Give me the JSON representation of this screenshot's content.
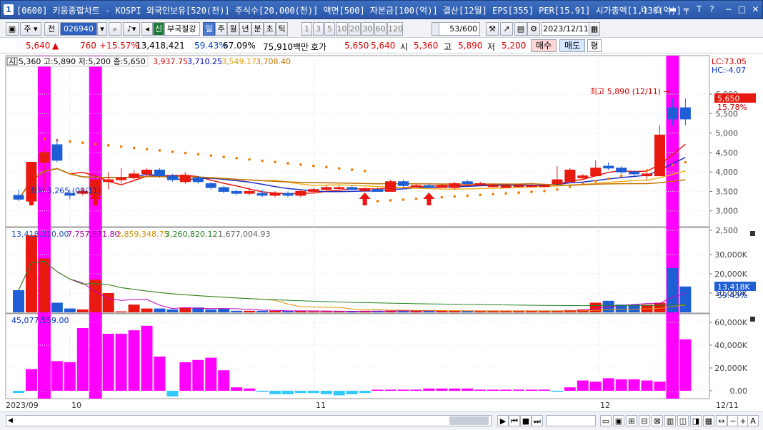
{
  "window": {
    "title": "[0600] 키움종합차트 - KOSPI 외국인보유[520(천)] 주식수[20,000(천)] 액면[500] 자본금[100(억)] 결산[12월] EPS[355] PER[15.91] 시가총액[1,130(억)]",
    "app_icon": "1",
    "buttons": {
      "restore": "⧉",
      "print": "⎙",
      "min": "▬",
      "pin": "╤",
      "tile": "T",
      "help": "?",
      "minimize": "−",
      "maximize": "□",
      "close": "✕"
    }
  },
  "toolbar": {
    "type_label": "주",
    "prev_label": "전",
    "code": "026940",
    "market_badge": "신",
    "stock_name": "부국철강",
    "periods": [
      "일",
      "주",
      "월",
      "년",
      "분",
      "초",
      "틱"
    ],
    "selected_period": "일",
    "intervals": [
      "1",
      "3",
      "5",
      "10",
      "20",
      "30",
      "60",
      "120"
    ],
    "count": "53/600",
    "date": "2023/12/11"
  },
  "quote": {
    "price": "5,640",
    "change_arrow": "▲",
    "change": "760",
    "change_pct": "+15.57%",
    "volume": "13,418,421",
    "vol_ratio": "59.43%",
    "turnover": "67.09%",
    "amount": "75,910백만",
    "hoga_label": "호가",
    "ask": "5,650",
    "bid": "5,640",
    "open_label": "시",
    "open": "5,360",
    "high_label": "고",
    "high": "5,890",
    "low_label": "저",
    "low": "5,200",
    "buy_label": "매수",
    "sell_label": "매도",
    "flat_label": "평"
  },
  "price_panel": {
    "ohlc_label": "시:5,360 고:5,890 저:5,200 종:5,650",
    "ma_values": [
      "3,937.75",
      "3,710.25",
      "3,549.17",
      "3,708.40"
    ],
    "ma_colors": [
      "#d00000",
      "#0000c0",
      "#e0a000",
      "#c07000"
    ],
    "lc": "LC:73.05",
    "hc": "HC:-4.07",
    "high_note": "최고 5,890 (12/11)",
    "low_note": "최저 3,265 (09/11)",
    "last_price": "5,650",
    "last_pct": "15.78%",
    "y_labels": [
      "6,000",
      "5,500",
      "5,000",
      "4,500",
      "4,000",
      "3,500",
      "3,000",
      "2,500"
    ]
  },
  "volume_panel": {
    "label_values": [
      "13,418,310.00",
      "7,757,571.80",
      "2,859,348.75",
      "3,260,820.12",
      "1,677,004.93"
    ],
    "label_colors": [
      "#2050c0",
      "#a000a0",
      "#d09000",
      "#208020",
      "#606060"
    ],
    "last_volume": "13,418K",
    "last_pct": "59.43%",
    "y_labels": [
      "30,000K",
      "20,000K",
      "10,000K"
    ]
  },
  "flow_panel": {
    "label": "45,077,559.00",
    "y_labels": [
      "60,000K",
      "40,000K",
      "20,000K",
      "0.00"
    ]
  },
  "x_axis": [
    "2023/09",
    "10",
    "11",
    "12",
    "12/11"
  ],
  "colors": {
    "up": "#e8190e",
    "down": "#1f5fd6",
    "highlight": "#ff00ff",
    "accent": "#2a57a8"
  },
  "chart_data": {
    "type": "candlestick",
    "ohlc_scale": [
      2500,
      6000
    ],
    "candles": [
      [
        3400,
        3550,
        3250,
        3300
      ],
      [
        3250,
        4250,
        3200,
        4250
      ],
      [
        4250,
        4650,
        3550,
        4500
      ],
      [
        4700,
        4850,
        4250,
        4300
      ],
      [
        3450,
        3550,
        3300,
        3400
      ],
      [
        3450,
        3600,
        3400,
        3500
      ],
      [
        3400,
        4000,
        3300,
        3800
      ],
      [
        3750,
        4000,
        3550,
        3800
      ],
      [
        3800,
        4100,
        3700,
        3850
      ],
      [
        3850,
        4050,
        3800,
        3950
      ],
      [
        3950,
        4100,
        3900,
        4050
      ],
      [
        4050,
        4100,
        3850,
        3900
      ],
      [
        3900,
        3950,
        3750,
        3800
      ],
      [
        3750,
        4000,
        3700,
        3900
      ],
      [
        3850,
        3900,
        3700,
        3750
      ],
      [
        3700,
        3750,
        3550,
        3600
      ],
      [
        3600,
        3650,
        3450,
        3500
      ],
      [
        3500,
        3550,
        3400,
        3450
      ],
      [
        3450,
        3600,
        3400,
        3500
      ],
      [
        3450,
        3550,
        3350,
        3400
      ],
      [
        3400,
        3500,
        3350,
        3450
      ],
      [
        3450,
        3500,
        3350,
        3400
      ],
      [
        3400,
        3550,
        3350,
        3500
      ],
      [
        3500,
        3600,
        3450,
        3550
      ],
      [
        3550,
        3650,
        3500,
        3600
      ],
      [
        3600,
        3650,
        3550,
        3600
      ],
      [
        3600,
        3650,
        3550,
        3550
      ],
      [
        3550,
        3600,
        3500,
        3550
      ],
      [
        3550,
        3600,
        3500,
        3500
      ],
      [
        3500,
        3800,
        3500,
        3750
      ],
      [
        3750,
        3800,
        3600,
        3650
      ],
      [
        3650,
        3700,
        3600,
        3650
      ],
      [
        3650,
        3700,
        3600,
        3600
      ],
      [
        3600,
        3700,
        3600,
        3650
      ],
      [
        3600,
        3750,
        3550,
        3700
      ],
      [
        3750,
        3800,
        3650,
        3700
      ],
      [
        3700,
        3750,
        3650,
        3700
      ],
      [
        3650,
        3700,
        3600,
        3650
      ],
      [
        3600,
        3700,
        3600,
        3650
      ],
      [
        3650,
        3700,
        3600,
        3650
      ],
      [
        3650,
        3700,
        3600,
        3650
      ],
      [
        3650,
        3700,
        3600,
        3650
      ],
      [
        3700,
        4150,
        3700,
        3800
      ],
      [
        3750,
        4100,
        3750,
        4050
      ],
      [
        3850,
        3950,
        3800,
        3900
      ],
      [
        3900,
        4300,
        3900,
        4100
      ],
      [
        4150,
        4250,
        4050,
        4100
      ],
      [
        4100,
        4150,
        3950,
        4000
      ],
      [
        4000,
        4050,
        3900,
        3950
      ],
      [
        3900,
        4000,
        3800,
        3950
      ],
      [
        3900,
        5200,
        3900,
        4950
      ],
      [
        5650,
        5890,
        5200,
        5360
      ],
      [
        5650,
        5890,
        5200,
        5360
      ]
    ],
    "volume_k": [
      11500,
      40000,
      28000,
      5000,
      2000,
      1500,
      17000,
      10000,
      500,
      4000,
      2000,
      2000,
      1500,
      2500,
      2500,
      1500,
      2000,
      800,
      800,
      800,
      800,
      800,
      800,
      500,
      500,
      500,
      500,
      800,
      800,
      800,
      800,
      800,
      800,
      800,
      800,
      800,
      800,
      800,
      800,
      800,
      800,
      800,
      800,
      1200,
      1500,
      5000,
      6000,
      4000,
      4000,
      4000,
      5000,
      23000,
      13418
    ],
    "flow_k": [
      -2000,
      19000,
      30000,
      26000,
      25000,
      55000,
      60000,
      50000,
      50000,
      53000,
      57000,
      30000,
      -5000,
      25000,
      27000,
      29000,
      18000,
      3000,
      2000,
      -1000,
      -3000,
      -3000,
      -2000,
      -2000,
      -3000,
      -4000,
      -3000,
      -2000,
      1000,
      1000,
      1000,
      1000,
      2000,
      2000,
      2000,
      2000,
      1000,
      1000,
      1000,
      1000,
      1000,
      1000,
      -1000,
      3000,
      9000,
      8000,
      11000,
      10000,
      10000,
      9000,
      8000,
      45000,
      45077
    ],
    "highlight_days": [
      2,
      6,
      51
    ],
    "buy_signal_days": [
      1,
      6,
      27,
      32
    ]
  }
}
